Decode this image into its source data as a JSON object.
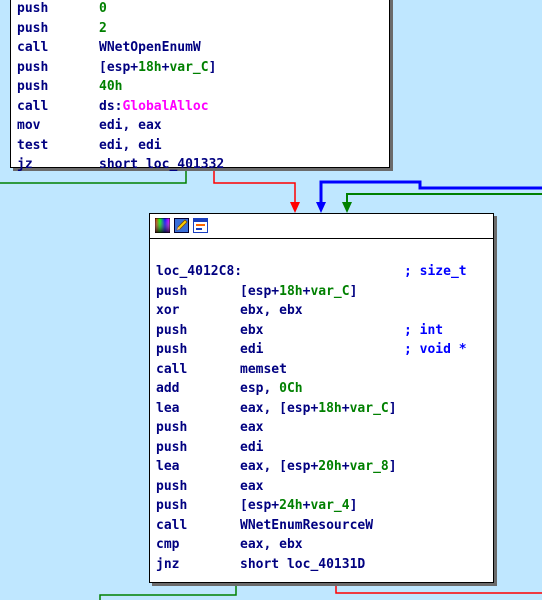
{
  "colors": {
    "background": "#bfe7ff",
    "edge_green": "#008000",
    "edge_red": "#ff0000",
    "edge_blue": "#0000ff",
    "mnemonic": "#000080",
    "number": "#008000",
    "import": "#ff00ff",
    "comment": "#0000ff"
  },
  "top_block": {
    "lines": [
      {
        "mn": "push",
        "ops": [
          {
            "t": "0",
            "c": "num"
          }
        ]
      },
      {
        "mn": "push",
        "ops": [
          {
            "t": "2",
            "c": "num"
          }
        ]
      },
      {
        "mn": "call",
        "ops": [
          {
            "t": "WNetOpenEnumW",
            "c": ""
          }
        ]
      },
      {
        "mn": "push",
        "ops": [
          {
            "t": "[esp+",
            "c": ""
          },
          {
            "t": "18h",
            "c": "num"
          },
          {
            "t": "+",
            "c": ""
          },
          {
            "t": "var_C",
            "c": "var"
          },
          {
            "t": "]",
            "c": ""
          }
        ]
      },
      {
        "mn": "push",
        "ops": [
          {
            "t": "40h",
            "c": "num"
          }
        ]
      },
      {
        "mn": "call",
        "ops": [
          {
            "t": "ds:",
            "c": ""
          },
          {
            "t": "GlobalAlloc",
            "c": "imp"
          }
        ]
      },
      {
        "mn": "mov",
        "ops": [
          {
            "t": "edi, eax",
            "c": ""
          }
        ]
      },
      {
        "mn": "test",
        "ops": [
          {
            "t": "edi, edi",
            "c": ""
          }
        ]
      },
      {
        "mn": "jz",
        "ops": [
          {
            "t": "short loc_401332",
            "c": ""
          }
        ]
      }
    ]
  },
  "main_block": {
    "toolbar_icons": [
      "color-palette-icon",
      "edit-pencil-icon",
      "graph-view-icon"
    ],
    "label": "loc_4012C8:",
    "label_comment": "; size_t",
    "lines": [
      {
        "mn": "push",
        "ops": [
          {
            "t": "[esp+",
            "c": ""
          },
          {
            "t": "18h",
            "c": "num"
          },
          {
            "t": "+",
            "c": ""
          },
          {
            "t": "var_C",
            "c": "var"
          },
          {
            "t": "]",
            "c": ""
          }
        ],
        "cm": ""
      },
      {
        "mn": "xor",
        "ops": [
          {
            "t": "ebx, ebx",
            "c": ""
          }
        ],
        "cm": ""
      },
      {
        "mn": "push",
        "ops": [
          {
            "t": "ebx",
            "c": ""
          }
        ],
        "cm": "; int"
      },
      {
        "mn": "push",
        "ops": [
          {
            "t": "edi",
            "c": ""
          }
        ],
        "cm": "; void *"
      },
      {
        "mn": "call",
        "ops": [
          {
            "t": "memset",
            "c": ""
          }
        ],
        "cm": ""
      },
      {
        "mn": "add",
        "ops": [
          {
            "t": "esp, ",
            "c": ""
          },
          {
            "t": "0Ch",
            "c": "num"
          }
        ],
        "cm": ""
      },
      {
        "mn": "lea",
        "ops": [
          {
            "t": "eax, [esp+",
            "c": ""
          },
          {
            "t": "18h",
            "c": "num"
          },
          {
            "t": "+",
            "c": ""
          },
          {
            "t": "var_C",
            "c": "var"
          },
          {
            "t": "]",
            "c": ""
          }
        ],
        "cm": ""
      },
      {
        "mn": "push",
        "ops": [
          {
            "t": "eax",
            "c": ""
          }
        ],
        "cm": ""
      },
      {
        "mn": "push",
        "ops": [
          {
            "t": "edi",
            "c": ""
          }
        ],
        "cm": ""
      },
      {
        "mn": "lea",
        "ops": [
          {
            "t": "eax, [esp+",
            "c": ""
          },
          {
            "t": "20h",
            "c": "num"
          },
          {
            "t": "+",
            "c": ""
          },
          {
            "t": "var_8",
            "c": "var"
          },
          {
            "t": "]",
            "c": ""
          }
        ],
        "cm": ""
      },
      {
        "mn": "push",
        "ops": [
          {
            "t": "eax",
            "c": ""
          }
        ],
        "cm": ""
      },
      {
        "mn": "push",
        "ops": [
          {
            "t": "[esp+",
            "c": ""
          },
          {
            "t": "24h",
            "c": "num"
          },
          {
            "t": "+",
            "c": ""
          },
          {
            "t": "var_4",
            "c": "var"
          },
          {
            "t": "]",
            "c": ""
          }
        ],
        "cm": ""
      },
      {
        "mn": "call",
        "ops": [
          {
            "t": "WNetEnumResourceW",
            "c": ""
          }
        ],
        "cm": ""
      },
      {
        "mn": "cmp",
        "ops": [
          {
            "t": "eax, ebx",
            "c": ""
          }
        ],
        "cm": ""
      },
      {
        "mn": "jnz",
        "ops": [
          {
            "t": "short loc_40131D",
            "c": ""
          }
        ],
        "cm": ""
      }
    ]
  }
}
